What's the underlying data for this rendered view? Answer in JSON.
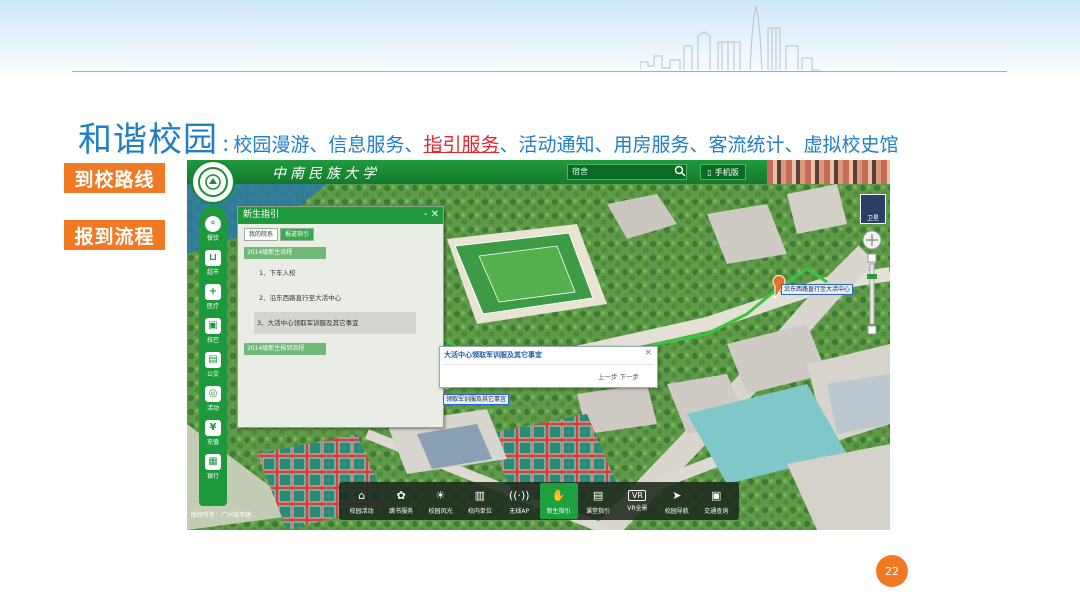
{
  "slide": {
    "title_main": "和谐校园",
    "title_sep": ":",
    "title_items_before": "校园漫游、信息服务、",
    "title_items_highlight": "指引服务",
    "title_items_after": "、活动通知、用房服务、客流统计、虚拟校史馆",
    "side_buttons": [
      "到校路线",
      "报到流程"
    ],
    "page_number": "22"
  },
  "app": {
    "university_name": "中南民族大学",
    "search_placeholder": "宿舍",
    "phone_button": "手机版",
    "satellite_label": "卫星",
    "left_nav": [
      "餐饮",
      "超市",
      "医疗",
      "校巴",
      "公交",
      "活动",
      "充值",
      "银行"
    ],
    "panel": {
      "title": "新生指引",
      "controls": "- ✕",
      "tabs": [
        "我的院系",
        "报道指引"
      ],
      "active_tab": 1,
      "sections": [
        "2014级新生流程",
        "2014级新生报到流程"
      ],
      "steps": [
        "1、下车入校",
        "2、沿东西路直行至大活中心",
        "3、大活中心领取军训服及其它事宜"
      ]
    },
    "popup": {
      "title": "大活中心领取军训服及其它事宜",
      "nav": "上一步 下一步",
      "close": "×"
    },
    "map_labels": [
      "沿东西路直行至大活中心",
      "领取军训服及其它事宜"
    ],
    "bottom_bar": [
      "校园活动",
      "跳书服务",
      "校园风光",
      "校内单位",
      "无线AP",
      "新生指引",
      "课堂指引",
      "VR全景",
      "校园导航",
      "交通查询"
    ],
    "bottom_active": 5,
    "copyright": "版权所有：广州城市建..."
  },
  "colors": {
    "accent_blue": "#1f7fc4",
    "highlight_red": "#e8262c",
    "orange": "#f07a24",
    "app_green": "#1f9a3c"
  }
}
